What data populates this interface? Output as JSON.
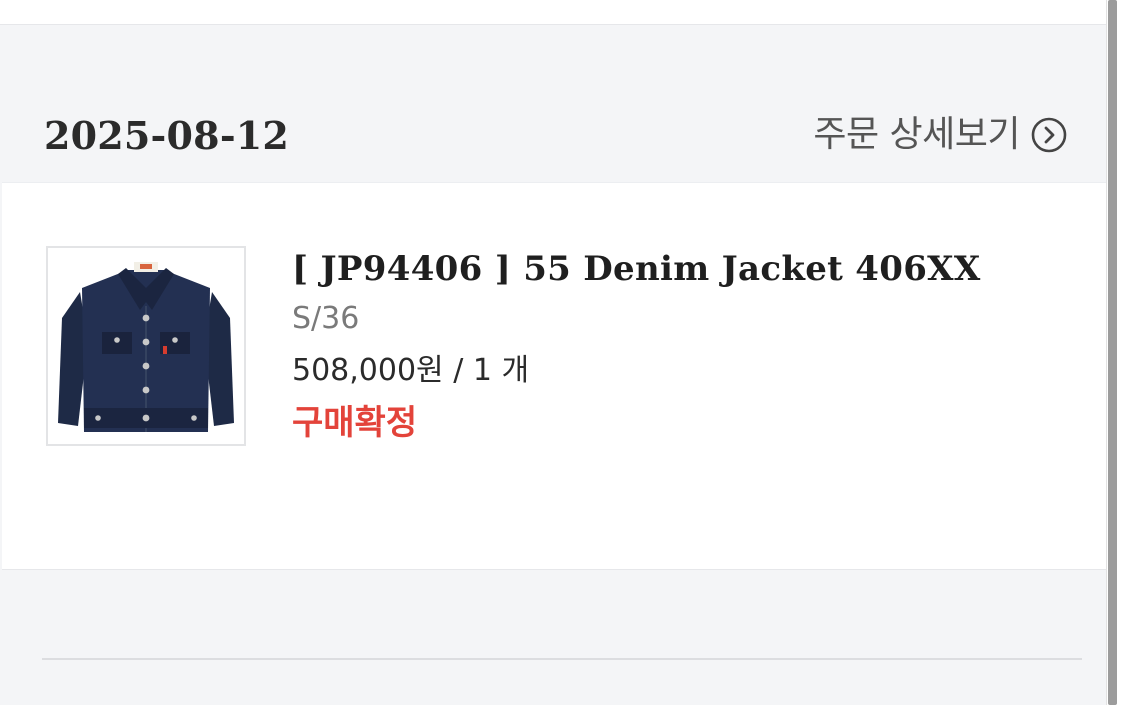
{
  "order": {
    "date": "2025-08-12",
    "detail_link_label": "주문 상세보기",
    "detail_link_icon": "chevron-right-circle-icon"
  },
  "item": {
    "title": "[ JP94406 ] 55 Denim Jacket 406XX",
    "option": "S/36",
    "price_qty": "508,000원 / 1 개",
    "status": "구매확정",
    "status_color": "#e3433a",
    "thumbnail": "denim-jacket-thumbnail"
  }
}
